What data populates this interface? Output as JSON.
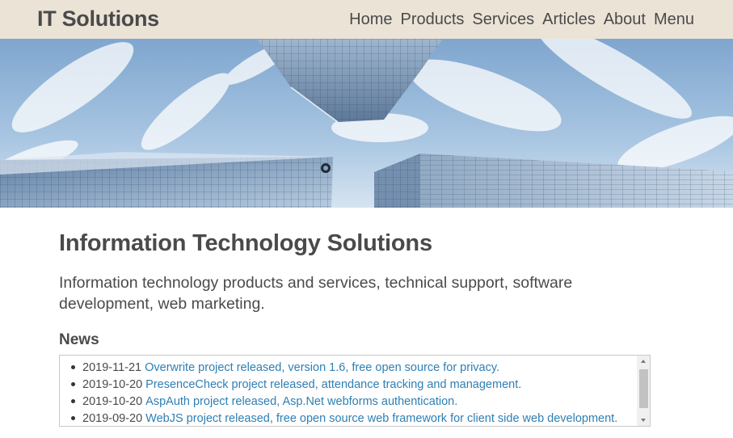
{
  "header": {
    "brand": "IT Solutions",
    "nav": [
      {
        "label": "Home"
      },
      {
        "label": "Products"
      },
      {
        "label": "Services"
      },
      {
        "label": "Articles"
      },
      {
        "label": "About"
      },
      {
        "label": "Menu"
      }
    ]
  },
  "main": {
    "title": "Information Technology Solutions",
    "lead": "Information technology products and services, technical support, software development, web marketing.",
    "news_heading": "News",
    "news": [
      {
        "date": "2019-11-21",
        "text": "Overwrite project released, version 1.6, free open source for privacy."
      },
      {
        "date": "2019-10-20",
        "text": "PresenceCheck project released, attendance tracking and management."
      },
      {
        "date": "2019-10-20",
        "text": "AspAuth project released, Asp.Net webforms authentication."
      },
      {
        "date": "2019-09-20",
        "text": "WebJS project released, free open source web framework for client side web development."
      }
    ]
  },
  "colors": {
    "header_bg": "#ebe3d6",
    "text": "#4a4a4a",
    "link": "#2e7fb5"
  }
}
